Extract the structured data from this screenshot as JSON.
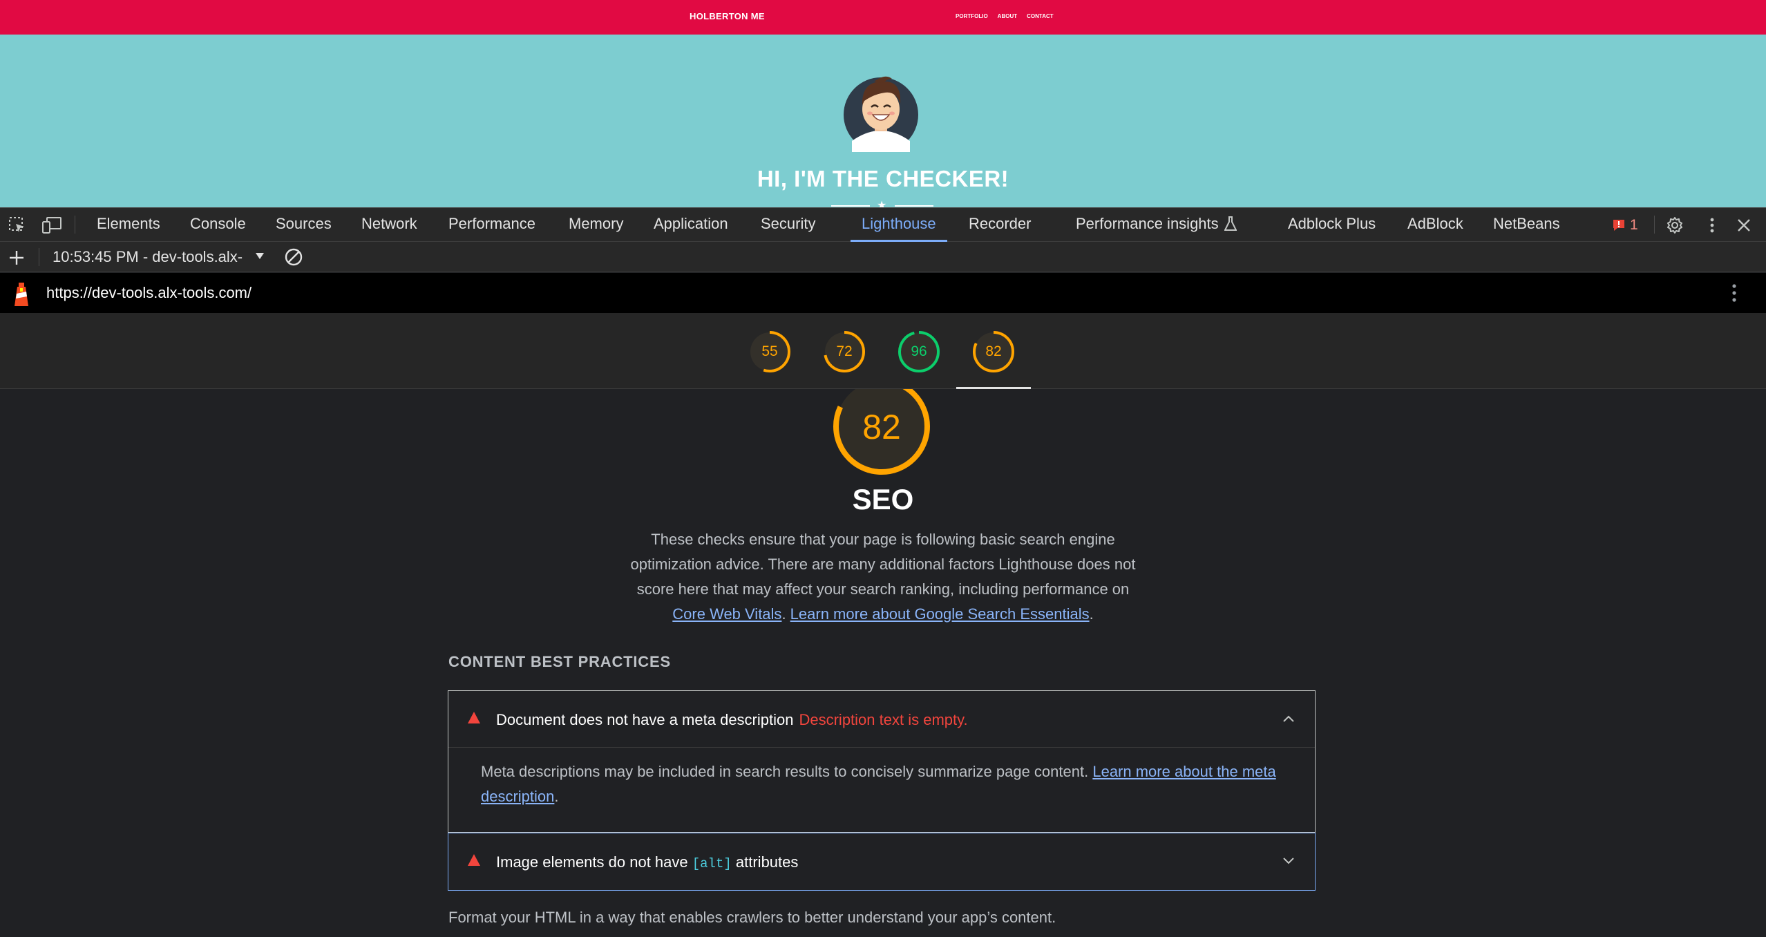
{
  "site": {
    "brand": "HOLBERTON ME",
    "nav_links": [
      "PORTFOLIO",
      "ABOUT",
      "CONTACT"
    ],
    "hero_title": "HI, I'M THE CHECKER!"
  },
  "devtools": {
    "tabs": [
      "Elements",
      "Console",
      "Sources",
      "Network",
      "Performance",
      "Memory",
      "Application",
      "Security",
      "Lighthouse",
      "Recorder",
      "Performance insights",
      "Adblock Plus",
      "AdBlock",
      "NetBeans"
    ],
    "active_tab": "Lighthouse",
    "issues_count": "1",
    "accent_color": "#7cacf8"
  },
  "lighthouse": {
    "report_selector": "10:53:45 PM - dev-tools.alx-",
    "url": "https://dev-tools.alx-tools.com/",
    "scores": [
      {
        "value": "55",
        "color": "#ffa400"
      },
      {
        "value": "72",
        "color": "#ffa400"
      },
      {
        "value": "96",
        "color": "#0cce6b"
      },
      {
        "value": "82",
        "color": "#ffa400"
      }
    ],
    "selected_score": "82"
  },
  "report": {
    "score": "82",
    "score_fraction": 0.82,
    "category_title": "SEO",
    "description_text": "These checks ensure that your page is following basic search engine optimization advice. There are many additional factors Lighthouse does not score here that may affect your search ranking, including performance on",
    "link_core_web_vitals": "Core Web Vitals",
    "link_search_essentials": "Learn more about Google Search Essentials",
    "group_title": "CONTENT BEST PRACTICES",
    "audits": [
      {
        "title": "Document does not have a meta description",
        "note": "Description text is empty.",
        "body": "Meta descriptions may be included in search results to concisely summarize page content.",
        "body_link": "Learn more about the meta description"
      },
      {
        "title_before": "Image elements do not have",
        "code": "[alt]",
        "title_after": "attributes"
      }
    ],
    "group_footer": "Format your HTML in a way that enables crawlers to better understand your app’s content.",
    "fail_color": "#f2453d"
  }
}
